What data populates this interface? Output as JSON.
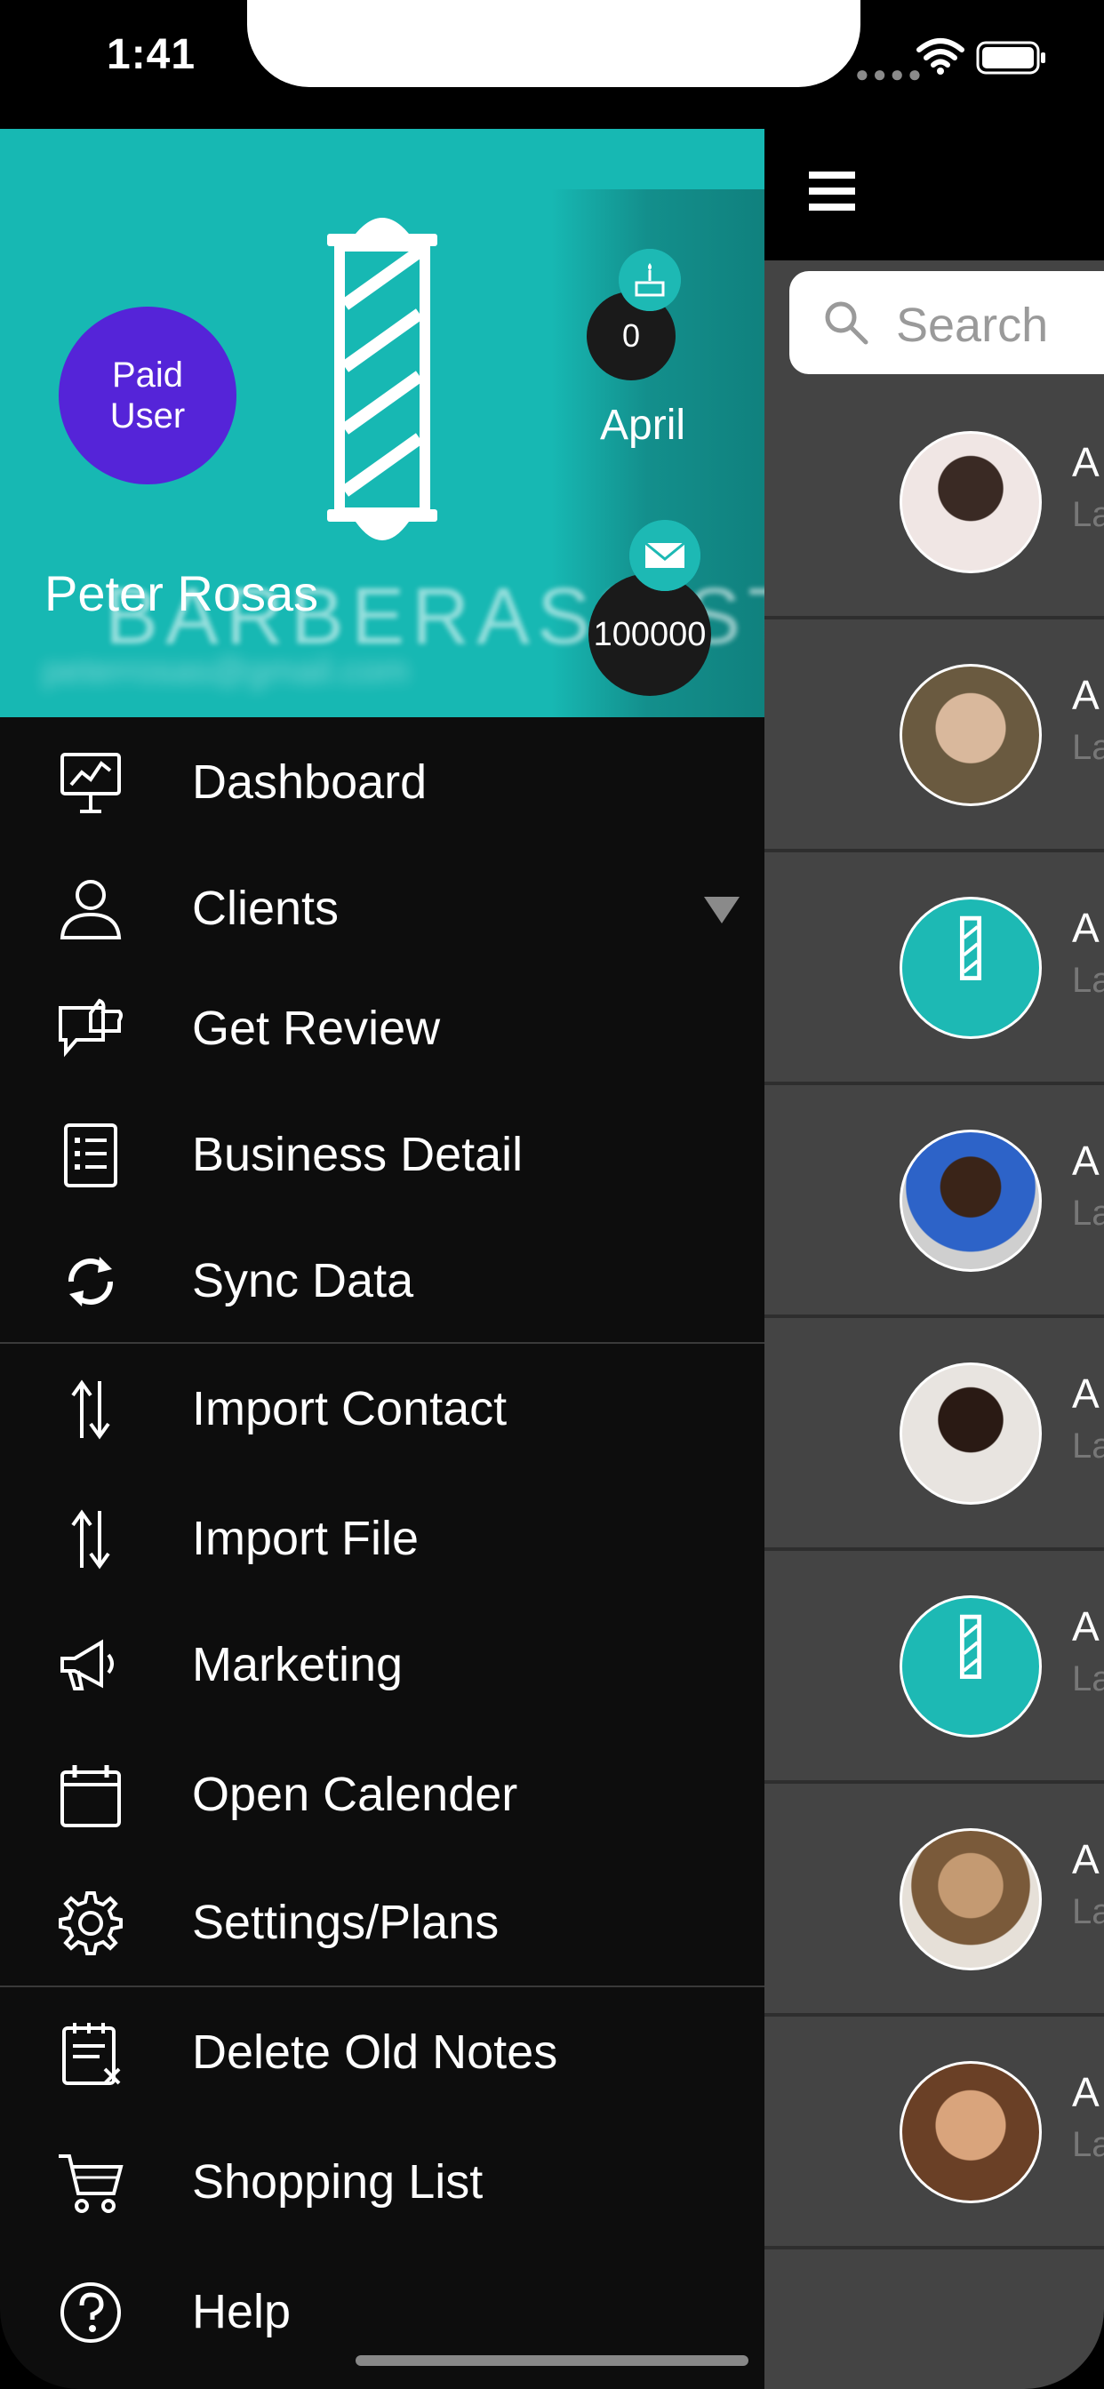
{
  "status": {
    "time": "1:41"
  },
  "header": {
    "badge_line1": "Paid",
    "badge_line2": "User",
    "user_name": "Peter Rosas",
    "brand_watermark": "BARBERASSIST",
    "birthday_count": "0",
    "month": "April",
    "message_count": "100000"
  },
  "menu": [
    {
      "label": "Dashboard",
      "icon": "dashboard-icon"
    },
    {
      "label": "Clients",
      "icon": "user-icon"
    },
    {
      "label": "Get Review",
      "icon": "review-icon"
    },
    {
      "label": "Business Detail",
      "icon": "list-icon"
    },
    {
      "label": "Sync Data",
      "icon": "sync-icon"
    },
    {
      "label": "Import Contact",
      "icon": "import-icon"
    },
    {
      "label": "Import File",
      "icon": "import-icon"
    },
    {
      "label": "Marketing",
      "icon": "megaphone-icon"
    },
    {
      "label": "Open Calender",
      "icon": "calendar-icon"
    },
    {
      "label": "Settings/Plans",
      "icon": "gear-icon"
    },
    {
      "label": "Delete Old Notes",
      "icon": "delete-notes-icon"
    },
    {
      "label": "Shopping List",
      "icon": "cart-icon"
    },
    {
      "label": "Help",
      "icon": "help-icon"
    }
  ],
  "search": {
    "placeholder": "Search"
  },
  "clients": [
    {
      "initial": "A",
      "sub": "La"
    },
    {
      "initial": "A",
      "sub": "La"
    },
    {
      "initial": "A",
      "sub": "La"
    },
    {
      "initial": "A",
      "sub": "La"
    },
    {
      "initial": "A",
      "sub": "La"
    },
    {
      "initial": "A",
      "sub": "La"
    },
    {
      "initial": "A",
      "sub": "La"
    },
    {
      "initial": "A",
      "sub": "La"
    }
  ],
  "colors": {
    "teal": "#17b8b3",
    "purple": "#5524d8",
    "drawer": "#0d0d0d"
  }
}
